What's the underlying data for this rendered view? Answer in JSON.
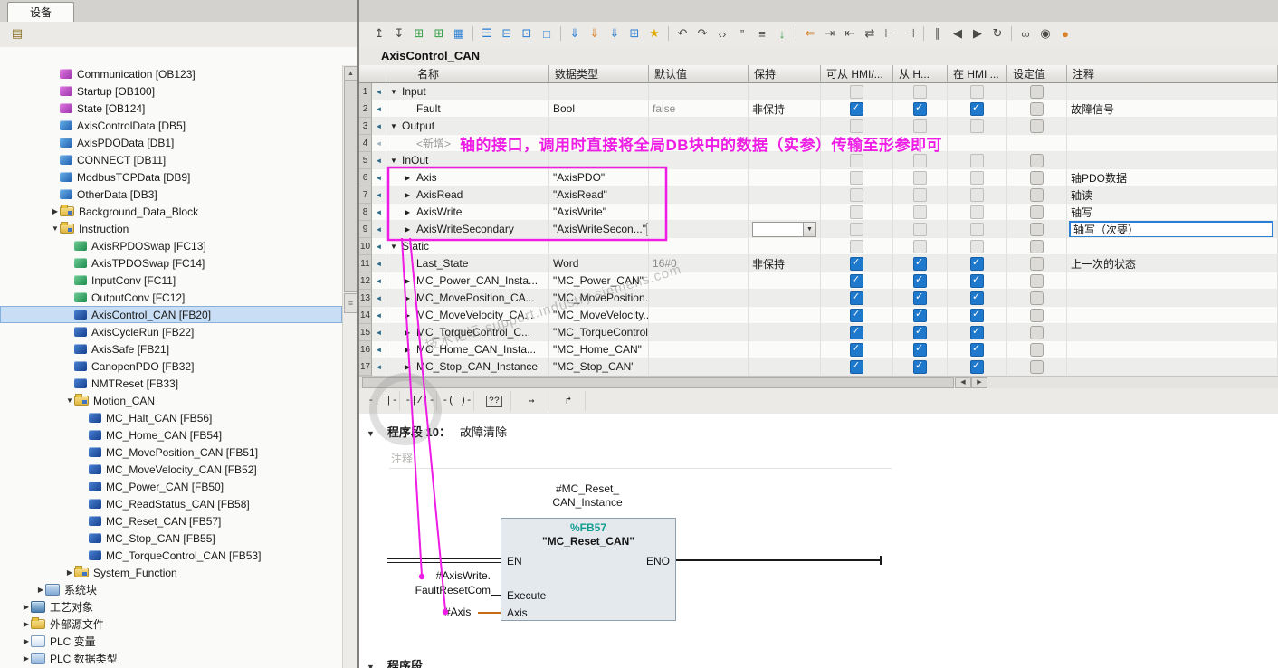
{
  "tabs": {
    "device": "设备"
  },
  "colors": {
    "annotation_magenta": "#ee1ce4",
    "checkbox_blue": "#1e79cc",
    "wire_orange": "#c96a14",
    "fb_number_teal": "#0f9b8e"
  },
  "icons": {
    "row_marker": "◄",
    "expanded": "▼",
    "collapsed": "▶",
    "browse": "…",
    "combo_arrow": "▼",
    "network_triangle": "▼"
  },
  "scrollbars": {
    "up": "▲",
    "left": "◀",
    "right": "▶",
    "grip": "≡"
  },
  "left_toolbar": {
    "icons": [
      {
        "name": "new-item-icon",
        "glyph": "▤",
        "color": "#8a6d1f"
      }
    ]
  },
  "toolbar": {
    "icons": [
      {
        "name": "insert-row-icon",
        "glyph": "↥"
      },
      {
        "name": "add-row-icon",
        "glyph": "↧"
      },
      {
        "name": "insert-row-after-icon",
        "glyph": "⊞",
        "color": "#2f9e44"
      },
      {
        "name": "add-row-after-icon",
        "glyph": "⊞",
        "color": "#2f9e44"
      },
      {
        "name": "keep-layout-icon",
        "glyph": "▦",
        "color": "#2a7fd4"
      },
      {
        "sep": true
      },
      {
        "name": "expand-networks-icon",
        "glyph": "☰",
        "color": "#2a7fd4"
      },
      {
        "name": "collapse-networks-icon",
        "glyph": "⊟",
        "color": "#2a7fd4"
      },
      {
        "name": "open-networks-icon",
        "glyph": "⊡",
        "color": "#2a7fd4"
      },
      {
        "name": "comment-toggle-icon",
        "glyph": "□",
        "color": "#2a7fd4"
      },
      {
        "sep": true
      },
      {
        "name": "download-icon",
        "glyph": "⇓",
        "color": "#2a7fd4"
      },
      {
        "name": "upload-icon",
        "glyph": "⇓",
        "color": "#d9822b"
      },
      {
        "name": "sync-icon",
        "glyph": "⇓",
        "color": "#2a7fd4"
      },
      {
        "name": "insert-box-icon",
        "glyph": "⊞",
        "color": "#2a7fd4"
      },
      {
        "name": "favorites-icon",
        "glyph": "★",
        "color": "#e0a800"
      },
      {
        "sep": true
      },
      {
        "name": "undo-icon",
        "glyph": "↶"
      },
      {
        "name": "redo-icon",
        "glyph": "↷"
      },
      {
        "name": "brackets-icon",
        "glyph": "‹›"
      },
      {
        "name": "quotes-icon",
        "glyph": "”"
      },
      {
        "name": "assignment-list-icon",
        "glyph": "≡"
      },
      {
        "name": "goto-next-icon",
        "glyph": "↓",
        "color": "#2f9e44"
      },
      {
        "sep": true
      },
      {
        "name": "jump-label-icon",
        "glyph": "⇐",
        "color": "#d9822b"
      },
      {
        "name": "indent-icon",
        "glyph": "⇥"
      },
      {
        "name": "outdent-icon",
        "glyph": "⇤"
      },
      {
        "name": "swap-operands-icon",
        "glyph": "⇄"
      },
      {
        "name": "open-branch-icon",
        "glyph": "⊢"
      },
      {
        "name": "close-branch-icon",
        "glyph": "⊣"
      },
      {
        "sep": true
      },
      {
        "name": "pause-icon",
        "glyph": "∥"
      },
      {
        "name": "previous-icon",
        "glyph": "◀"
      },
      {
        "name": "next-icon",
        "glyph": "▶"
      },
      {
        "name": "refresh-icon",
        "glyph": "↻"
      },
      {
        "sep": true
      },
      {
        "name": "glasses-monitor-icon",
        "glyph": "∞"
      },
      {
        "name": "monitor-all-icon",
        "glyph": "◉"
      },
      {
        "name": "lock-icon",
        "glyph": "●",
        "color": "#d9822b"
      }
    ]
  },
  "tree": {
    "items": [
      {
        "label": "Communication [OB123]",
        "icon": "ob",
        "level": 3
      },
      {
        "label": "Startup [OB100]",
        "icon": "ob",
        "level": 3
      },
      {
        "label": "State [OB124]",
        "icon": "ob",
        "level": 3
      },
      {
        "label": "AxisControlData [DB5]",
        "icon": "db",
        "level": 3
      },
      {
        "label": "AxisPDOData [DB1]",
        "icon": "db",
        "level": 3
      },
      {
        "label": "CONNECT [DB11]",
        "icon": "db",
        "level": 3
      },
      {
        "label": "ModbusTCPData [DB9]",
        "icon": "db",
        "level": 3
      },
      {
        "label": "OtherData [DB3]",
        "icon": "db",
        "level": 3
      },
      {
        "label": "Background_Data_Block",
        "icon": "folder",
        "level": 3,
        "arrow": "collapsed"
      },
      {
        "label": "Instruction",
        "icon": "folder",
        "level": 3,
        "arrow": "expanded"
      },
      {
        "label": "AxisRPDOSwap [FC13]",
        "icon": "fc",
        "level": 4
      },
      {
        "label": "AxisTPDOSwap [FC14]",
        "icon": "fc",
        "level": 4
      },
      {
        "label": "InputConv [FC11]",
        "icon": "fc",
        "level": 4
      },
      {
        "label": "OutputConv [FC12]",
        "icon": "fc",
        "level": 4
      },
      {
        "label": "AxisControl_CAN [FB20]",
        "icon": "fb",
        "level": 4,
        "selected": true
      },
      {
        "label": "AxisCycleRun [FB22]",
        "icon": "fb",
        "level": 4
      },
      {
        "label": "AxisSafe [FB21]",
        "icon": "fb",
        "level": 4
      },
      {
        "label": "CanopenPDO [FB32]",
        "icon": "fb",
        "level": 4
      },
      {
        "label": "NMTReset [FB33]",
        "icon": "fb",
        "level": 4
      },
      {
        "label": "Motion_CAN",
        "icon": "folder",
        "level": 4,
        "arrow": "expanded"
      },
      {
        "label": "MC_Halt_CAN [FB56]",
        "icon": "fb",
        "level": 5
      },
      {
        "label": "MC_Home_CAN [FB54]",
        "icon": "fb",
        "level": 5
      },
      {
        "label": "MC_MovePosition_CAN [FB51]",
        "icon": "fb",
        "level": 5
      },
      {
        "label": "MC_MoveVelocity_CAN [FB52]",
        "icon": "fb",
        "level": 5
      },
      {
        "label": "MC_Power_CAN [FB50]",
        "icon": "fb",
        "level": 5
      },
      {
        "label": "MC_ReadStatus_CAN [FB58]",
        "icon": "fb",
        "level": 5
      },
      {
        "label": "MC_Reset_CAN [FB57]",
        "icon": "fb",
        "level": 5
      },
      {
        "label": "MC_Stop_CAN [FB55]",
        "icon": "fb",
        "level": 5
      },
      {
        "label": "MC_TorqueControl_CAN [FB53]",
        "icon": "fb",
        "level": 5
      },
      {
        "label": "System_Function",
        "icon": "folder",
        "level": 4,
        "arrow": "collapsed"
      },
      {
        "label": "系统块",
        "icon": "sysfolder",
        "level": 2,
        "arrow": "collapsed"
      },
      {
        "label": "工艺对象",
        "icon": "tech",
        "level": 1,
        "arrow": "collapsed"
      },
      {
        "label": "外部源文件",
        "icon": "extsrc",
        "level": 1,
        "arrow": "collapsed"
      },
      {
        "label": "PLC 变量",
        "icon": "tags",
        "level": 1,
        "arrow": "collapsed"
      },
      {
        "label": "PLC 数据类型",
        "icon": "types",
        "level": 1,
        "arrow": "collapsed"
      }
    ]
  },
  "editor": {
    "title": "AxisControl_CAN",
    "table": {
      "headers": [
        "名称",
        "数据类型",
        "默认值",
        "保持",
        "可从 HMI/...",
        "从 H...",
        "在 HMI ...",
        "设定值",
        "注释"
      ],
      "rows": [
        {
          "num": "1",
          "expander": "down",
          "name": "Input",
          "boxes": [
            "dis",
            "dis",
            "dis",
            "dis"
          ]
        },
        {
          "num": "2",
          "indent": 1,
          "name": "Fault",
          "type": "Bool",
          "default": "false",
          "retain": "非保持",
          "boxes": [
            "chk",
            "chk",
            "chk",
            "dis"
          ],
          "comment": "故障信号"
        },
        {
          "num": "3",
          "expander": "down",
          "name": "Output",
          "boxes": [
            "dis",
            "dis",
            "dis",
            "dis"
          ]
        },
        {
          "num": "4",
          "indent": 1,
          "name": "<新增>",
          "newitem": true,
          "boxes": [
            "none",
            "none",
            "none",
            "none"
          ]
        },
        {
          "num": "5",
          "expander": "down",
          "name": "InOut",
          "boxes": [
            "dis",
            "dis",
            "dis",
            "dis"
          ]
        },
        {
          "num": "6",
          "indent": 1,
          "expander": "right",
          "name": "Axis",
          "type": "\"AxisPDO\"",
          "boxes": [
            "dis",
            "dis",
            "dis",
            "dis"
          ],
          "comment": "轴PDO数据"
        },
        {
          "num": "7",
          "indent": 1,
          "expander": "right",
          "name": "AxisRead",
          "type": "\"AxisRead\"",
          "boxes": [
            "dis",
            "dis",
            "dis",
            "dis"
          ],
          "comment": "轴读"
        },
        {
          "num": "8",
          "indent": 1,
          "expander": "right",
          "name": "AxisWrite",
          "type": "\"AxisWrite\"",
          "boxes": [
            "dis",
            "dis",
            "dis",
            "dis"
          ],
          "comment": "轴写"
        },
        {
          "num": "9",
          "indent": 1,
          "expander": "right",
          "name": "AxisWriteSecondary",
          "type": "\"AxisWriteSecon...\"",
          "type_browse": true,
          "retain_dropdown": true,
          "boxes": [
            "dis",
            "dis",
            "dis",
            "dis"
          ],
          "comment": "轴写（次要）",
          "comment_editing": true
        },
        {
          "num": "10",
          "expander": "down",
          "name": "Static",
          "boxes": [
            "dis",
            "dis",
            "dis",
            "dis"
          ]
        },
        {
          "num": "11",
          "indent": 1,
          "name": "Last_State",
          "type": "Word",
          "default": "16#0",
          "retain": "非保持",
          "boxes": [
            "chk",
            "chk",
            "chk",
            "dis"
          ],
          "comment": "上一次的状态"
        },
        {
          "num": "12",
          "indent": 1,
          "expander": "right",
          "name": "MC_Power_CAN_Insta...",
          "type": "\"MC_Power_CAN\"",
          "boxes": [
            "chk",
            "chk",
            "chk",
            "dis"
          ]
        },
        {
          "num": "13",
          "indent": 1,
          "expander": "right",
          "name": "MC_MovePosition_CA...",
          "type": "\"MC_MovePosition...\"",
          "boxes": [
            "chk",
            "chk",
            "chk",
            "dis"
          ]
        },
        {
          "num": "14",
          "indent": 1,
          "expander": "right",
          "name": "MC_MoveVelocity_CA...",
          "type": "\"MC_MoveVelocity...\"",
          "boxes": [
            "chk",
            "chk",
            "chk",
            "dis"
          ]
        },
        {
          "num": "15",
          "indent": 1,
          "expander": "right",
          "name": "MC_TorqueControl_C...",
          "type": "\"MC_TorqueControl...\"",
          "boxes": [
            "chk",
            "chk",
            "chk",
            "dis"
          ]
        },
        {
          "num": "16",
          "indent": 1,
          "expander": "right",
          "name": "MC_Home_CAN_Insta...",
          "type": "\"MC_Home_CAN\"",
          "boxes": [
            "chk",
            "chk",
            "chk",
            "dis"
          ]
        },
        {
          "num": "17",
          "indent": 1,
          "expander": "right",
          "name": "MC_Stop_CAN_Instance",
          "type": "\"MC_Stop_CAN\"",
          "boxes": [
            "chk",
            "chk",
            "chk",
            "dis"
          ]
        }
      ]
    },
    "annotation": {
      "text": "轴的接口，调用时直接将全局DB块中的数据（实参）传输至形参即可"
    },
    "lad_toolbar": {
      "items": [
        {
          "name": "open-contact-icon",
          "glyph": "-| |-"
        },
        {
          "name": "closed-contact-icon",
          "glyph": "-|/|-"
        },
        {
          "name": "coil-icon",
          "glyph": "-( )-"
        },
        {
          "name": "empty-box-icon",
          "glyph": "??",
          "boxed": true
        },
        {
          "name": "open-branch-icon",
          "glyph": "↦"
        },
        {
          "name": "close-branch-icon",
          "glyph": "↱"
        }
      ]
    },
    "network": {
      "label": "程序段 10：",
      "title": "故障清除",
      "comment_placeholder": "注释",
      "instance_line1": "#MC_Reset_",
      "instance_line2": "CAN_Instance",
      "block_number": "%FB57",
      "block_name": "\"MC_Reset_CAN\"",
      "pins": {
        "en": "EN",
        "eno": "ENO",
        "execute": "Execute",
        "axis": "Axis"
      },
      "operands": {
        "execute_line1": "#AxisWrite.",
        "execute_line2": "FaultResetCom",
        "axis": "#Axis"
      },
      "next_label": "程序段"
    },
    "watermark": {
      "text": "技术论坛 support.industry.siemens.com"
    }
  }
}
